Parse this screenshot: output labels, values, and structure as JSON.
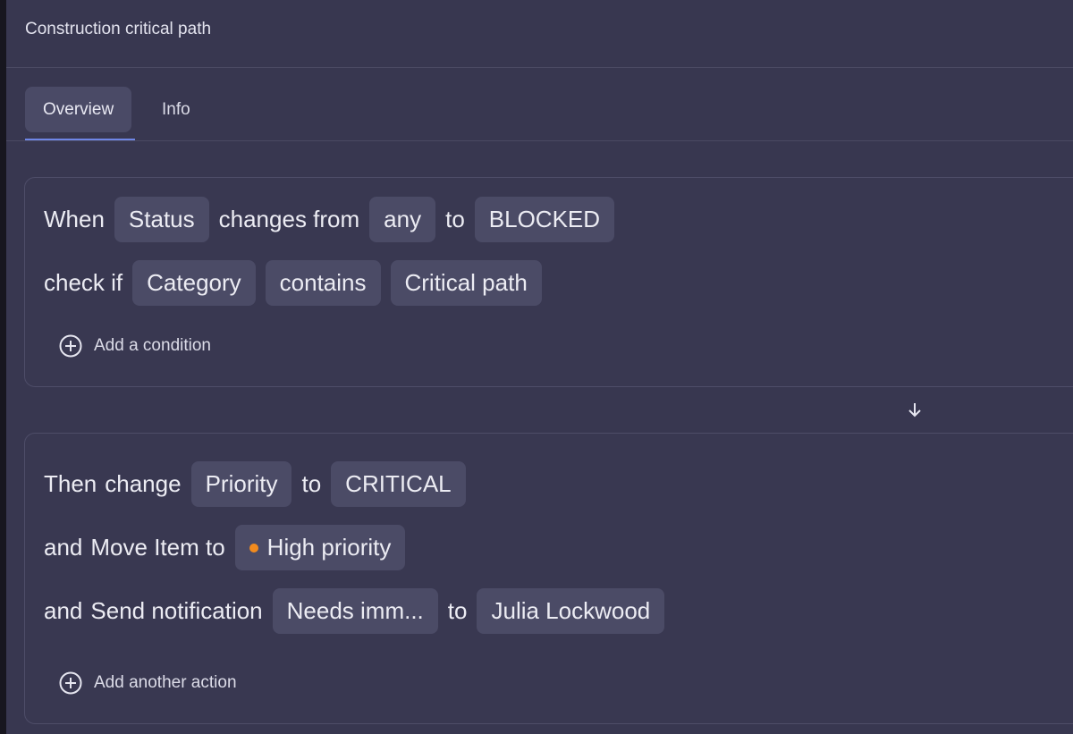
{
  "header": {
    "title": "Construction critical path"
  },
  "tabs": [
    {
      "label": "Overview",
      "active": true
    },
    {
      "label": "Info",
      "active": false
    }
  ],
  "trigger": {
    "row1": {
      "when": "When",
      "field": "Status",
      "changes_from": "changes from",
      "from_value": "any",
      "to": "to",
      "to_value": "BLOCKED"
    },
    "row2": {
      "check_if": "check if",
      "field": "Category",
      "operator": "contains",
      "value": "Critical path"
    },
    "add_condition": "Add a condition"
  },
  "actions": {
    "row1": {
      "then": "Then",
      "change": "change",
      "field": "Priority",
      "to": "to",
      "value": "CRITICAL"
    },
    "row2": {
      "and": "and",
      "move": "Move Item to",
      "target": "High priority",
      "target_dot_color": "#f28b1e"
    },
    "row3": {
      "and": "and",
      "send": "Send notification",
      "message": "Needs imm...",
      "to": "to",
      "recipient": "Julia Lockwood"
    },
    "add_action": "Add another action"
  },
  "icons": {
    "add": "plus-circle-icon",
    "flow": "arrow-down-icon"
  }
}
